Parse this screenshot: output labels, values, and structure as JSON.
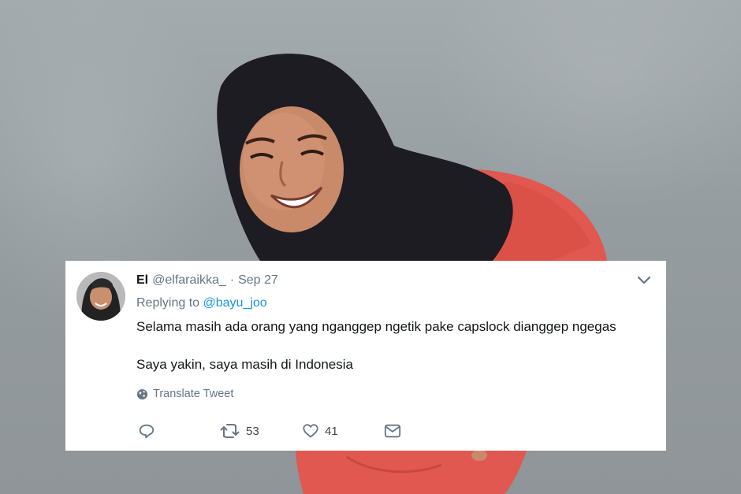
{
  "tweet": {
    "display_name": "El",
    "handle": "@elfaraikka_",
    "separator": "·",
    "date": "Sep 27",
    "replying_prefix": "Replying to",
    "replying_to": "@bayu_joo",
    "text_lines": [
      "Selama masih ada orang yang nganggep ngetik pake capslock dianggep ngegas",
      "Saya yakin, saya masih di Indonesia"
    ],
    "translate_label": "Translate Tweet",
    "actions": {
      "reply_icon": "reply-icon",
      "retweet_icon": "retweet-icon",
      "retweet_count": "53",
      "like_icon": "heart-icon",
      "like_count": "41",
      "dm_icon": "envelope-icon"
    }
  },
  "colors": {
    "name": "#14171a",
    "secondary": "#657786",
    "link": "#1b95e0",
    "card_bg": "#ffffff"
  }
}
